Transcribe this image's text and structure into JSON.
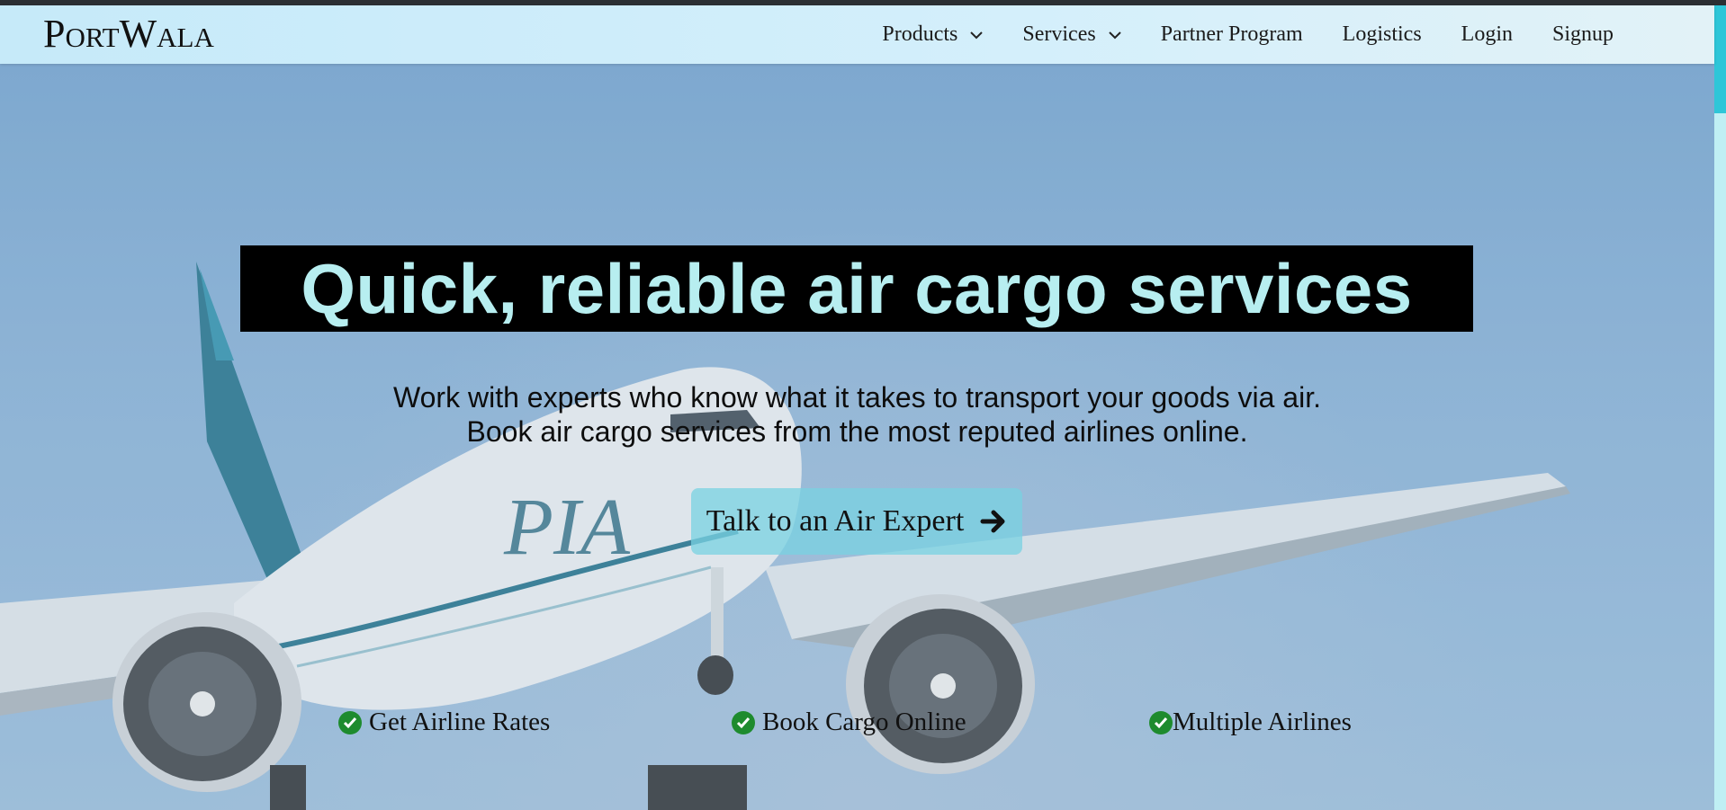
{
  "brand": {
    "logo_text": "PortWala"
  },
  "nav": {
    "items": [
      {
        "label": "Products",
        "has_dropdown": true
      },
      {
        "label": "Services",
        "has_dropdown": true
      },
      {
        "label": "Partner Program",
        "has_dropdown": false
      },
      {
        "label": "Logistics",
        "has_dropdown": false
      },
      {
        "label": "Login",
        "has_dropdown": false
      },
      {
        "label": "Signup",
        "has_dropdown": false
      }
    ]
  },
  "hero": {
    "headline": "Quick, reliable air cargo services",
    "subline1": "Work with experts who know what it takes to transport your goods via air.",
    "subline2": "Book air cargo services from the most reputed airlines online.",
    "cta_label": "Talk to an Air Expert",
    "cta_icon": "arrow-right-icon",
    "features": [
      {
        "label": "Get Airline Rates",
        "icon": "check-circle-icon"
      },
      {
        "label": "Book Cargo Online",
        "icon": "check-circle-icon"
      },
      {
        "label": "Multiple Airlines",
        "icon": "check-circle-icon"
      }
    ],
    "plane_livery_text": "PIA"
  },
  "colors": {
    "headline_bg": "#000000",
    "headline_text": "#b7eef0",
    "cta_bg": "#78d2e1",
    "check_green": "#1e8b2e",
    "scroll_accent": "#2ec6d8"
  }
}
